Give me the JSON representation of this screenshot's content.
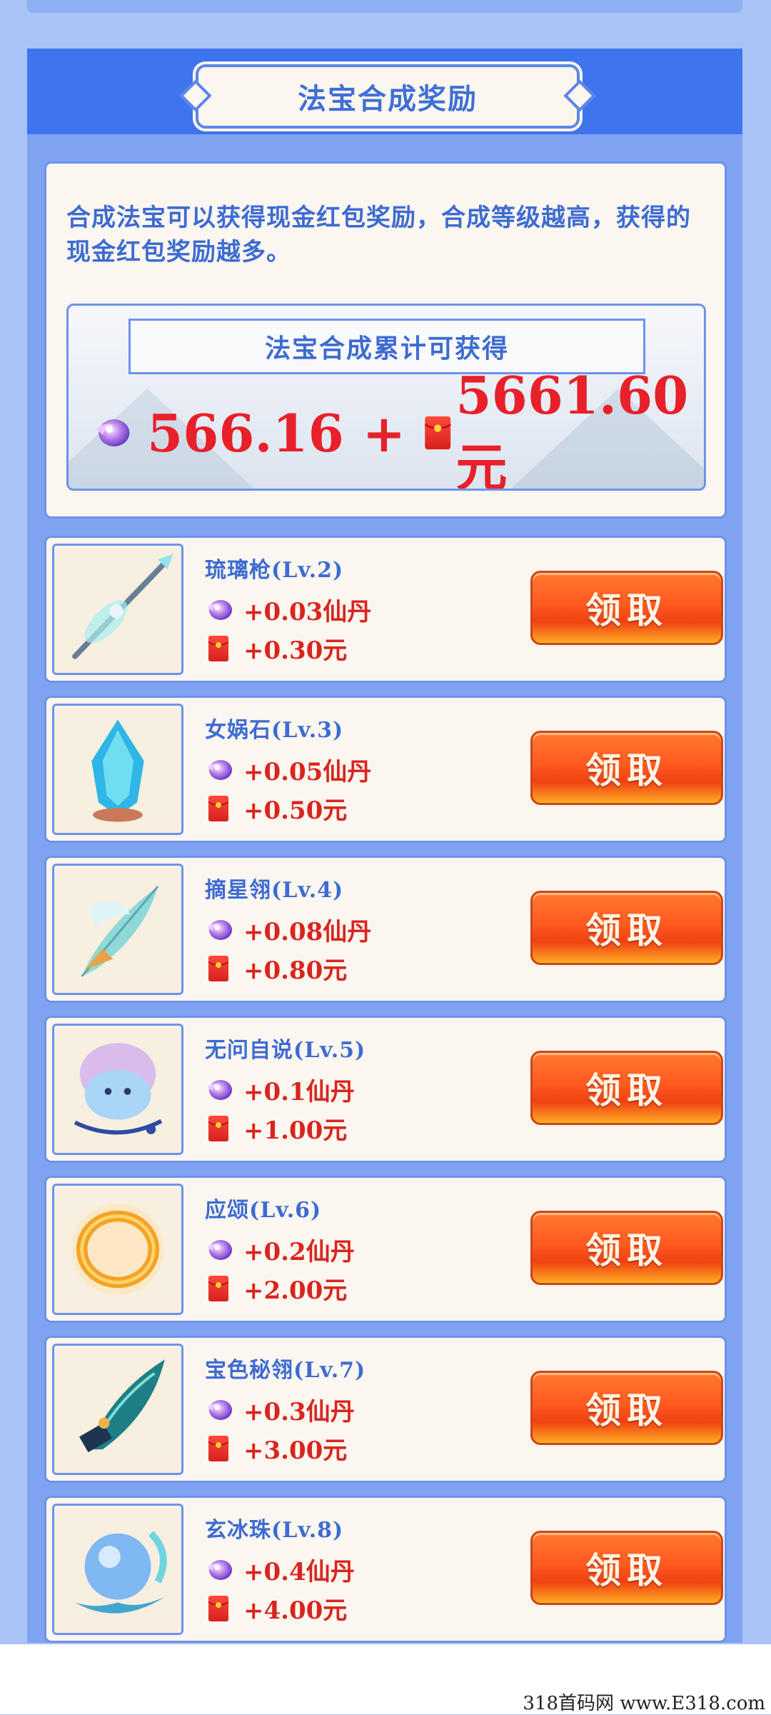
{
  "panel": {
    "title": "法宝合成奖励"
  },
  "info": {
    "description": "合成法宝可以获得现金红包奖励，合成等级越高，获得的现金红包奖励越多。",
    "total_label": "法宝合成累计可获得",
    "total_dan": "566.16",
    "plus": "+",
    "total_cash": "5661.60元"
  },
  "items": [
    {
      "name": "琉璃枪(Lv.2)",
      "dan": "+0.03仙丹",
      "cash": "+0.30元",
      "button": "领取",
      "icon": "spear-icon"
    },
    {
      "name": "女娲石(Lv.3)",
      "dan": "+0.05仙丹",
      "cash": "+0.50元",
      "button": "领取",
      "icon": "crystal-stone-icon"
    },
    {
      "name": "摘星翎(Lv.4)",
      "dan": "+0.08仙丹",
      "cash": "+0.80元",
      "button": "领取",
      "icon": "feather-icon"
    },
    {
      "name": "无问自说(Lv.5)",
      "dan": "+0.1仙丹",
      "cash": "+1.00元",
      "button": "领取",
      "icon": "spirit-orb-icon"
    },
    {
      "name": "应颂(Lv.6)",
      "dan": "+0.2仙丹",
      "cash": "+2.00元",
      "button": "领取",
      "icon": "golden-ring-icon"
    },
    {
      "name": "宝色秘翎(Lv.7)",
      "dan": "+0.3仙丹",
      "cash": "+3.00元",
      "button": "领取",
      "icon": "dark-feather-icon"
    },
    {
      "name": "玄冰珠(Lv.8)",
      "dan": "+0.4仙丹",
      "cash": "+4.00元",
      "button": "领取",
      "icon": "ice-pearl-icon"
    }
  ],
  "colors": {
    "accent_blue": "#3f74ef",
    "reward_red": "#d9251f",
    "button_orange": "#ff5a1f"
  },
  "watermark": "318首码网 www.E318.com"
}
